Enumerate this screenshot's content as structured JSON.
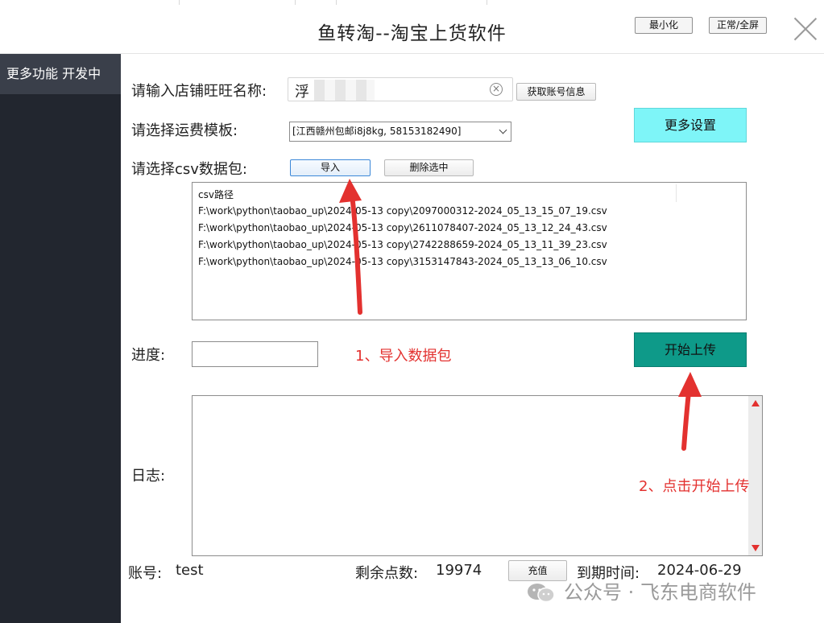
{
  "window": {
    "title": "鱼转淘--淘宝上货软件",
    "minimize_label": "最小化",
    "fullscreen_label": "正常/全屏"
  },
  "sidebar": {
    "items": [
      {
        "label": "更多功能 开发中"
      }
    ]
  },
  "form": {
    "shop_label": "请输入店铺旺旺名称:",
    "shop_value": "浮",
    "get_account_label": "获取账号信息",
    "shipping_label": "请选择运费模板:",
    "shipping_selected": "[江西赣州包邮i8j8kg, 58153182490]",
    "more_settings_label": "更多设置",
    "csv_label": "请选择csv数据包:",
    "import_label": "导入",
    "delete_selected_label": "删除选中"
  },
  "csv_list": {
    "header": "csv路径",
    "rows": [
      "F:\\work\\python\\taobao_up\\2024-05-13 copy\\2097000312-2024_05_13_15_07_19.csv",
      "F:\\work\\python\\taobao_up\\2024-05-13 copy\\2611078407-2024_05_13_12_24_43.csv",
      "F:\\work\\python\\taobao_up\\2024-05-13 copy\\2742288659-2024_05_13_11_39_23.csv",
      "F:\\work\\python\\taobao_up\\2024-05-13 copy\\3153147843-2024_05_13_13_06_10.csv"
    ]
  },
  "progress": {
    "label": "进度:",
    "value": 0
  },
  "start_upload_label": "开始上传",
  "log": {
    "label": "日志:"
  },
  "annotations": {
    "step1": "1、导入数据包",
    "step2": "2、点击开始上传",
    "color": "#e3312f"
  },
  "footer": {
    "account_label": "账号:",
    "account_value": "test",
    "points_label": "剩余点数:",
    "points_value": "19974",
    "recharge_label": "充值",
    "expiry_label": "到期时间:",
    "expiry_value": "2024-06-29"
  },
  "watermark": {
    "icon": "wechat-icon",
    "text": "公众号 · 飞东电商软件"
  },
  "colors": {
    "sidebar_bg": "#22262f",
    "sidebar_item_bg": "#3a3f4a",
    "more_settings_bg": "#7ef5f8",
    "start_upload_bg": "#0e9a89"
  }
}
